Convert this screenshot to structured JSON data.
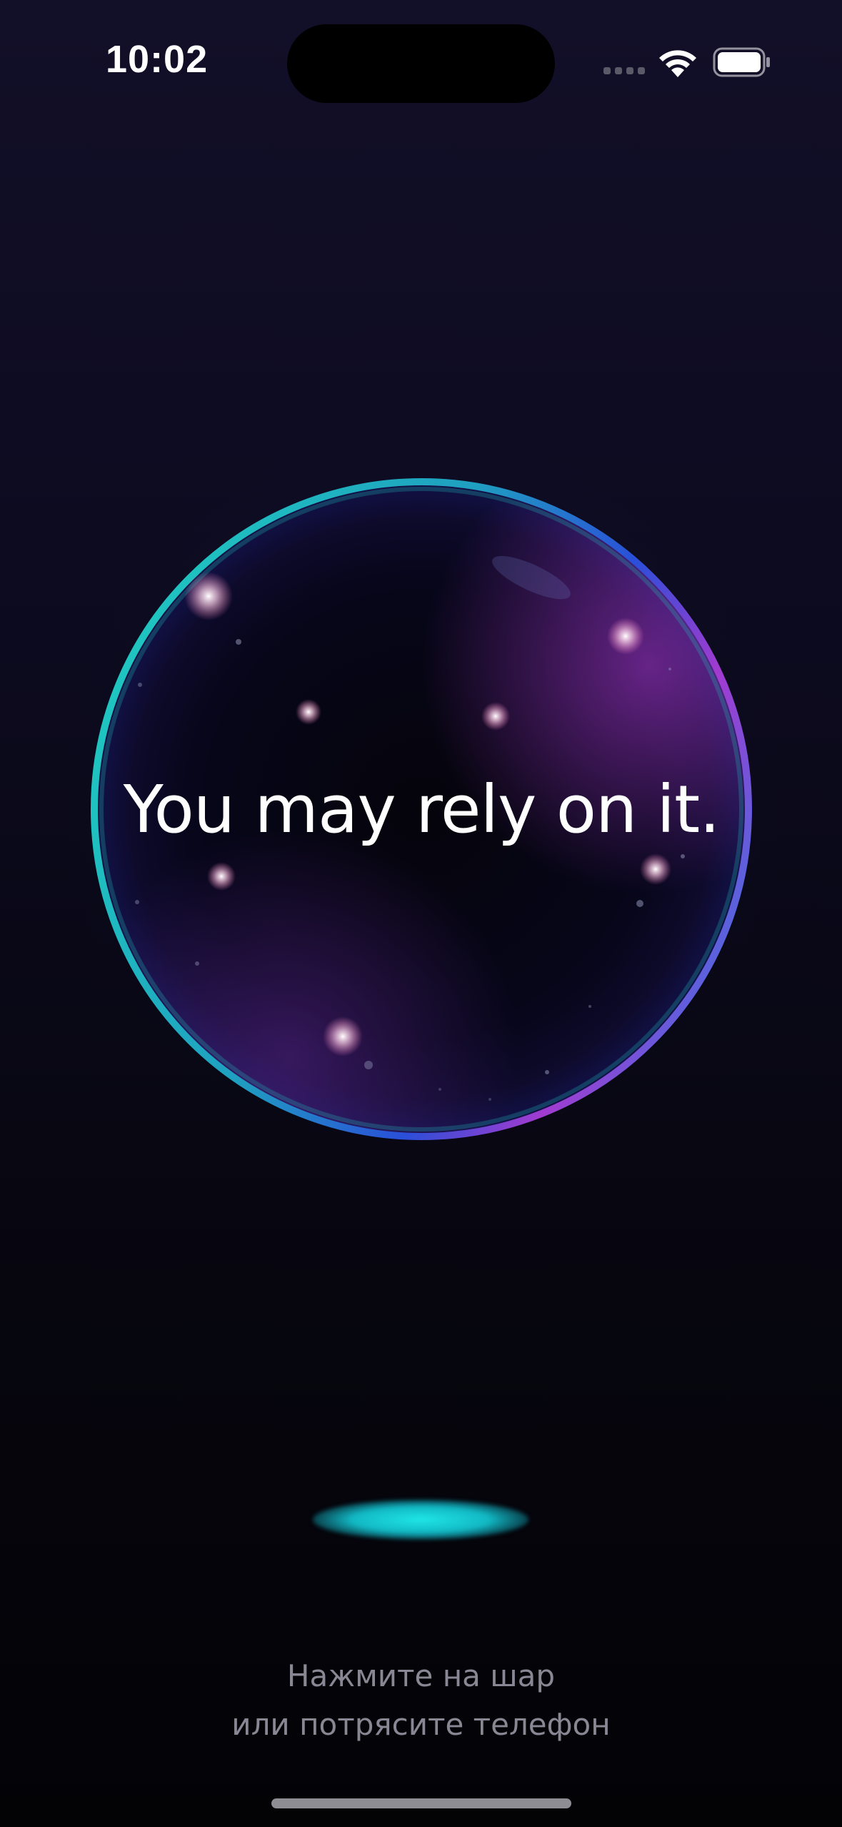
{
  "status_bar": {
    "time": "10:02",
    "wifi_icon": "wifi-icon",
    "battery_icon": "battery-icon",
    "signal_icon": "cellular-signal-icon"
  },
  "orb": {
    "answer": "You may rely on it.",
    "rim_colors": [
      "#1fc8c0",
      "#2a4fd8",
      "#a23bd0"
    ]
  },
  "hint": {
    "line1": "Нажмите на шар",
    "line2": "или потрясите телефон"
  },
  "colors": {
    "background_top": "#120f28",
    "background_bottom": "#030306",
    "accent_glow": "#1fe6e6"
  }
}
